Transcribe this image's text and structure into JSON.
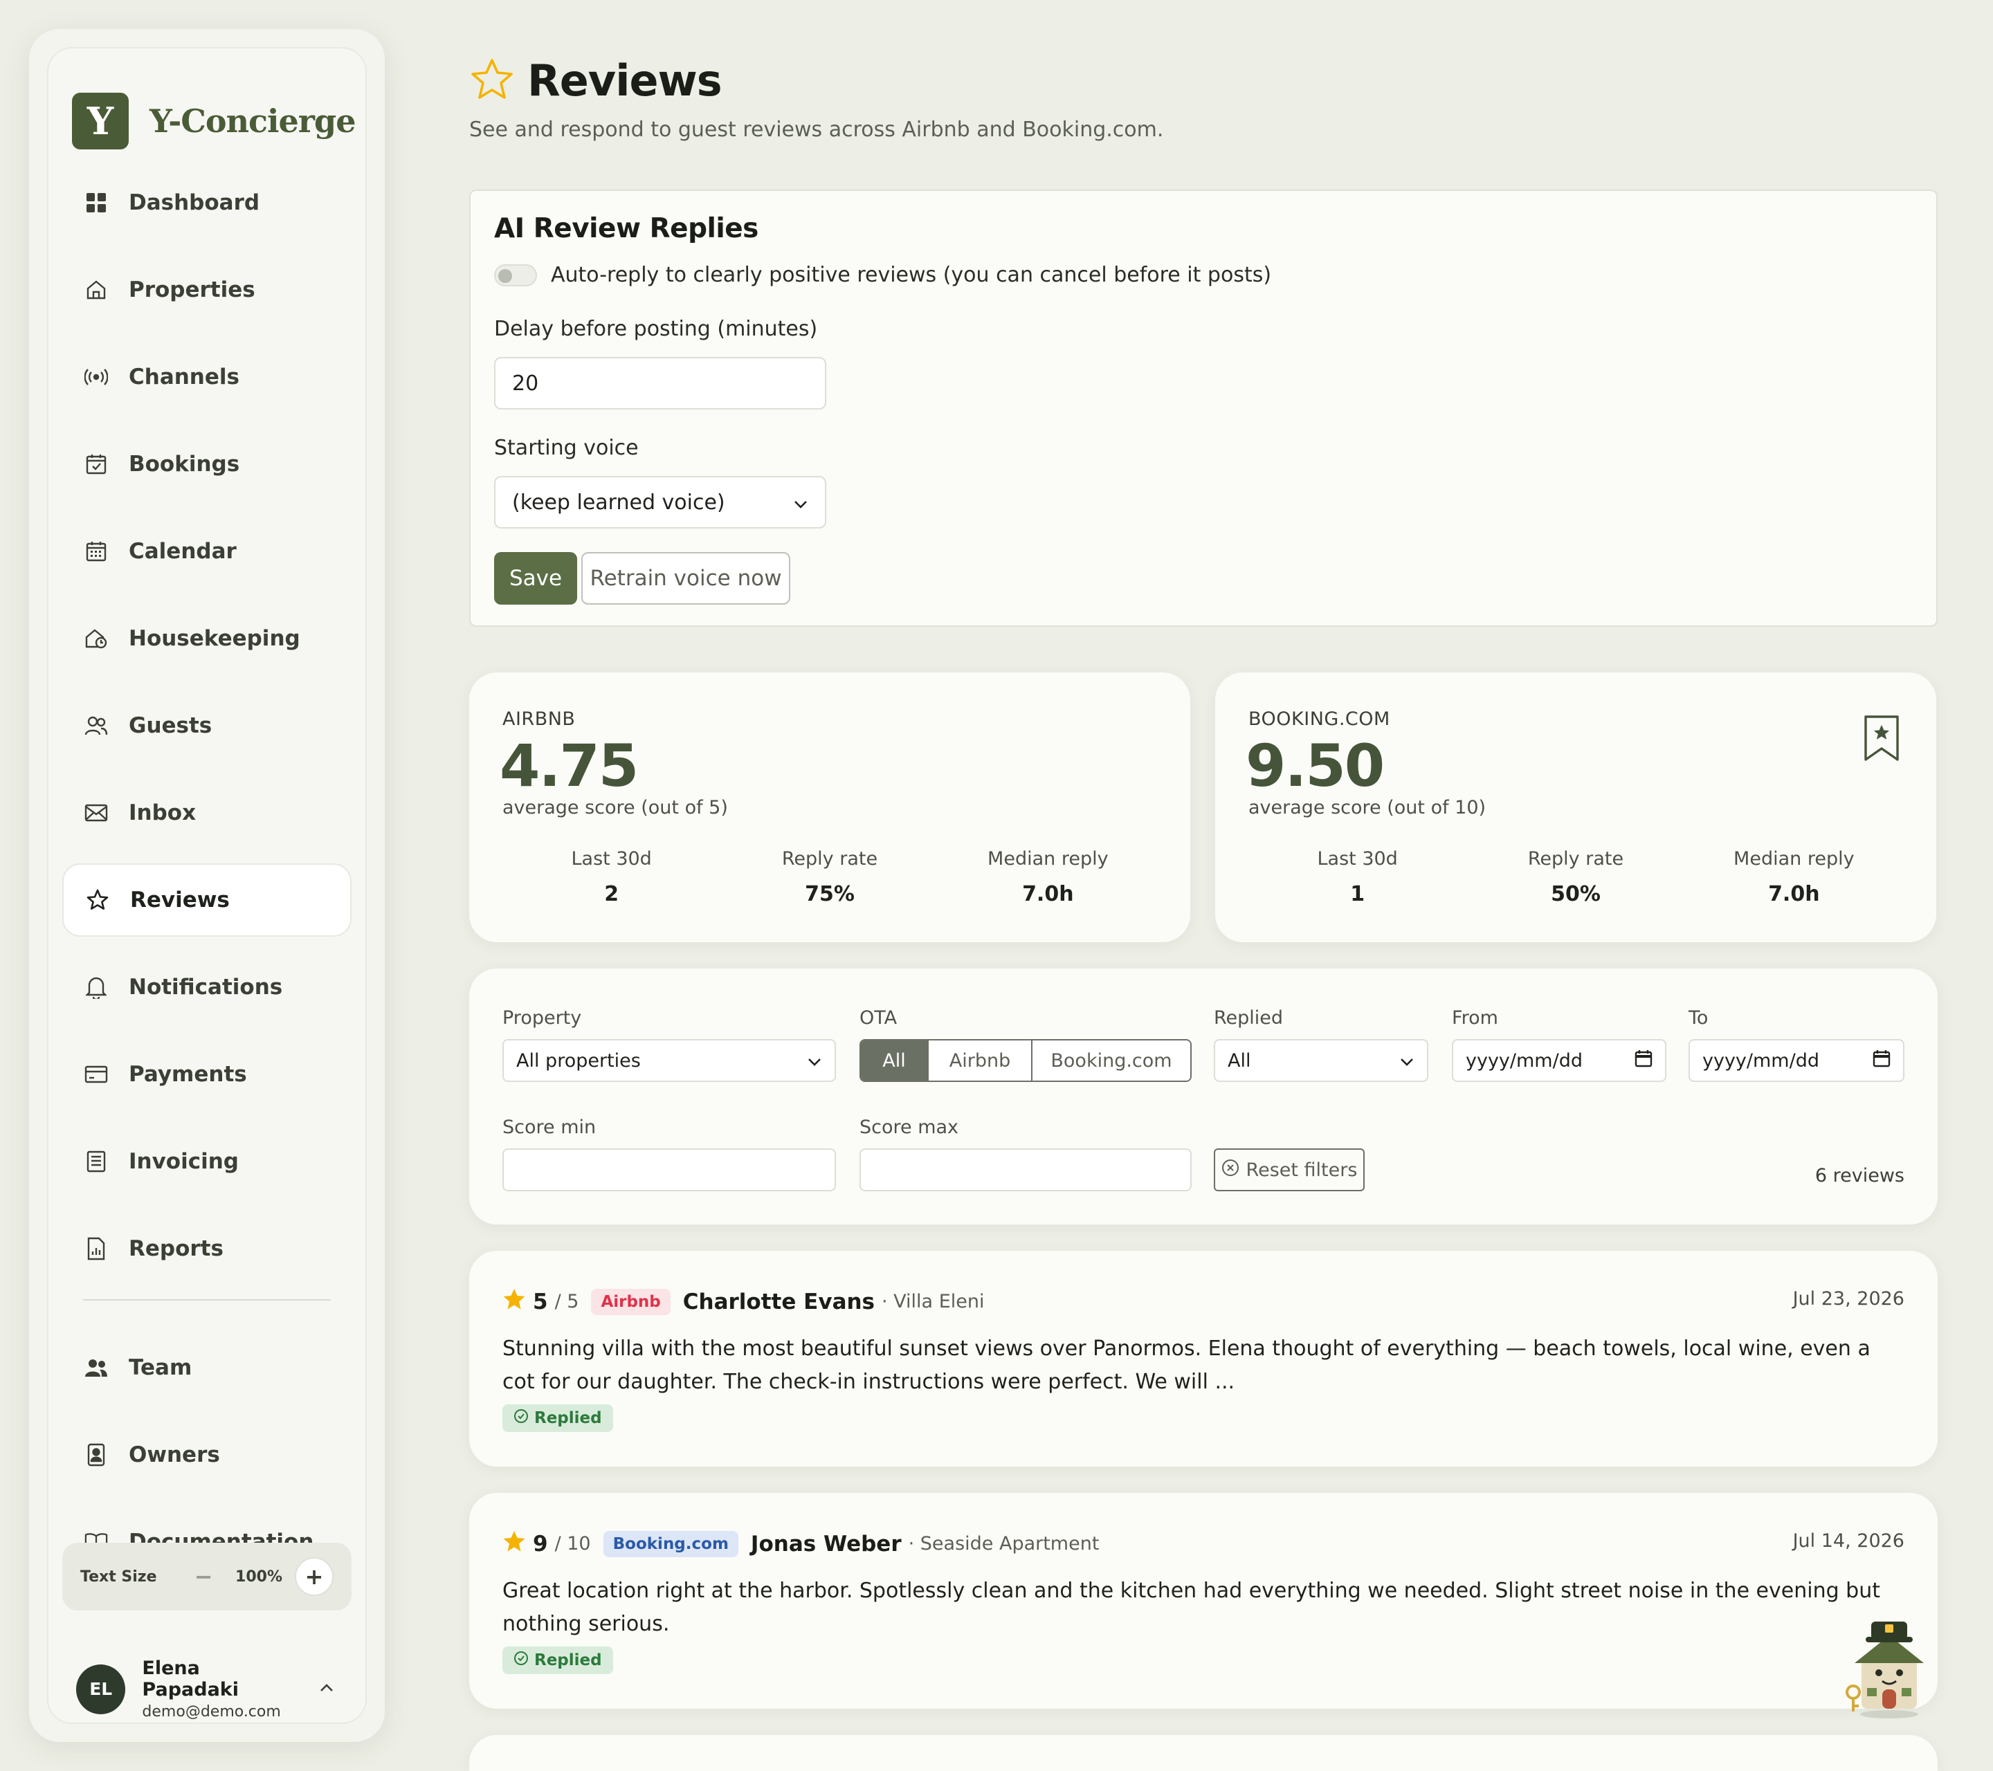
{
  "brand": {
    "logo_letter": "Y",
    "name": "Y-Concierge"
  },
  "sidebar": {
    "items": [
      {
        "label": "Dashboard",
        "icon": "dashboard-icon"
      },
      {
        "label": "Properties",
        "icon": "house-icon"
      },
      {
        "label": "Channels",
        "icon": "broadcast-icon"
      },
      {
        "label": "Bookings",
        "icon": "calendar-check-icon"
      },
      {
        "label": "Calendar",
        "icon": "calendar-icon"
      },
      {
        "label": "Housekeeping",
        "icon": "house-clock-icon"
      },
      {
        "label": "Guests",
        "icon": "users-icon"
      },
      {
        "label": "Inbox",
        "icon": "mail-icon"
      },
      {
        "label": "Reviews",
        "icon": "star-icon",
        "active": true
      },
      {
        "label": "Notifications",
        "icon": "bell-icon"
      },
      {
        "label": "Payments",
        "icon": "credit-card-icon"
      },
      {
        "label": "Invoicing",
        "icon": "invoice-icon"
      },
      {
        "label": "Reports",
        "icon": "report-icon"
      }
    ],
    "secondary": [
      {
        "label": "Team",
        "icon": "team-icon"
      },
      {
        "label": "Owners",
        "icon": "owner-icon"
      },
      {
        "label": "Documentation",
        "icon": "book-icon"
      }
    ],
    "text_size": {
      "label": "Text Size",
      "value": "100%",
      "minus": "−",
      "plus": "+"
    },
    "user": {
      "initials": "EL",
      "name": "Elena Papadaki",
      "email": "demo@demo.com"
    }
  },
  "page": {
    "title": "Reviews",
    "subtitle": "See and respond to guest reviews across Airbnb and Booking.com."
  },
  "ai_replies": {
    "title": "AI Review Replies",
    "auto_reply_label": "Auto-reply to clearly positive reviews (you can cancel before it posts)",
    "auto_reply_enabled": false,
    "delay_label": "Delay before posting (minutes)",
    "delay_value": "20",
    "voice_label": "Starting voice",
    "voice_value": "(keep learned voice)",
    "save_label": "Save",
    "retrain_label": "Retrain voice now"
  },
  "stats": [
    {
      "ota": "AIRBNB",
      "score": "4.75",
      "avg_label": "average score (out of 5)",
      "metrics": [
        {
          "label": "Last 30d",
          "value": "2"
        },
        {
          "label": "Reply rate",
          "value": "75%"
        },
        {
          "label": "Median reply",
          "value": "7.0h"
        }
      ]
    },
    {
      "ota": "BOOKING.COM",
      "score": "9.50",
      "avg_label": "average score (out of 10)",
      "metrics": [
        {
          "label": "Last 30d",
          "value": "1"
        },
        {
          "label": "Reply rate",
          "value": "50%"
        },
        {
          "label": "Median reply",
          "value": "7.0h"
        }
      ]
    }
  ],
  "filters": {
    "property_label": "Property",
    "property_value": "All properties",
    "ota_label": "OTA",
    "ota_options": [
      "All",
      "Airbnb",
      "Booking.com"
    ],
    "ota_selected": "All",
    "replied_label": "Replied",
    "replied_value": "All",
    "from_label": "From",
    "from_placeholder": "yyyy/mm/dd",
    "to_label": "To",
    "to_placeholder": "yyyy/mm/dd",
    "score_min_label": "Score min",
    "score_max_label": "Score max",
    "reset_label": "Reset filters",
    "count": "6 reviews"
  },
  "reviews": [
    {
      "score": "5",
      "out_of": "/ 5",
      "ota": "Airbnb",
      "guest": "Charlotte Evans",
      "property": "· Villa Eleni",
      "date": "Jul 23, 2026",
      "text": "Stunning villa with the most beautiful sunset views over Panormos. Elena thought of everything — beach towels, local wine, even a cot for our daughter. The check-in instructions were perfect. We will ...",
      "status": "Replied"
    },
    {
      "score": "9",
      "out_of": "/ 10",
      "ota": "Booking.com",
      "guest": "Jonas Weber",
      "property": "· Seaside Apartment",
      "date": "Jul 14, 2026",
      "text": "Great location right at the harbor. Spotlessly clean and the kitchen had everything we needed. Slight street noise in the evening but nothing serious.",
      "status": "Replied"
    }
  ],
  "colors": {
    "accent": "#4a5b37",
    "button": "#5c6e45",
    "airbnb": "#e0334a",
    "booking": "#2a5aa8",
    "star": "#f5b301"
  }
}
